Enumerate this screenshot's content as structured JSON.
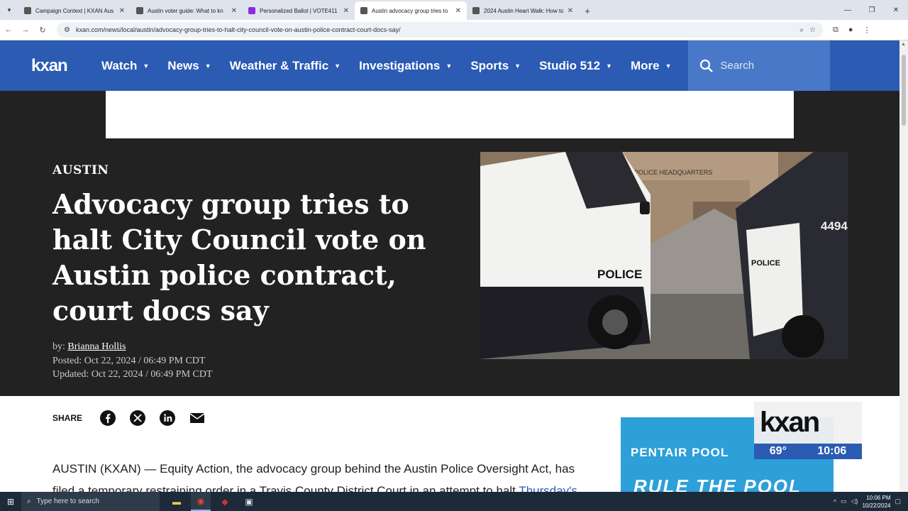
{
  "browser": {
    "tabs": [
      {
        "label": "Campaign Context | KXAN Aus",
        "active": false
      },
      {
        "label": "Austin voter guide: What to kn",
        "active": false
      },
      {
        "label": "Personalized Ballot | VOTE411",
        "active": false
      },
      {
        "label": "Austin advocacy group tries to",
        "active": true
      },
      {
        "label": "2024 Austin Heart Walk: How to",
        "active": false
      }
    ],
    "url": "kxan.com/news/local/austin/advocacy-group-tries-to-halt-city-council-vote-on-austin-police-contract-court-docs-say/"
  },
  "site": {
    "logo": "kxan",
    "nav": [
      "Watch",
      "News",
      "Weather & Traffic",
      "Investigations",
      "Sports",
      "Studio 512",
      "More"
    ],
    "search_placeholder": "Search",
    "brand_color": "#2b5bb3"
  },
  "article": {
    "kicker": "AUSTIN",
    "headline": "Advocacy group tries to halt City Council vote on Austin police contract, court docs say",
    "by_label": "by:",
    "author": "Brianna Hollis",
    "posted": "Posted: Oct 22, 2024 / 06:49 PM CDT",
    "updated": "Updated: Oct 22, 2024 / 06:49 PM CDT",
    "share_label": "SHARE",
    "body_line1": "AUSTIN (KXAN) — Equity Action, the advocacy group behind the Austin Police Oversight Act, has",
    "body_line2": "filed a temporary restraining order in a Travis County District Court in an attempt to halt ",
    "body_link": "Thursday's",
    "photo_texts": {
      "building": "POLICE HEADQUARTERS",
      "car_left": "POLICE",
      "car_right": "POLICE",
      "unit": "4494"
    }
  },
  "ad": {
    "brand": "PENTAIR POOL",
    "slogan": "RULE THE POOL"
  },
  "bug": {
    "logo": "kxan",
    "temp": "69°",
    "time": "10:06"
  },
  "taskbar": {
    "search_placeholder": "Type here to search",
    "clock_time": "10:06 PM",
    "clock_date": "10/22/2024"
  }
}
